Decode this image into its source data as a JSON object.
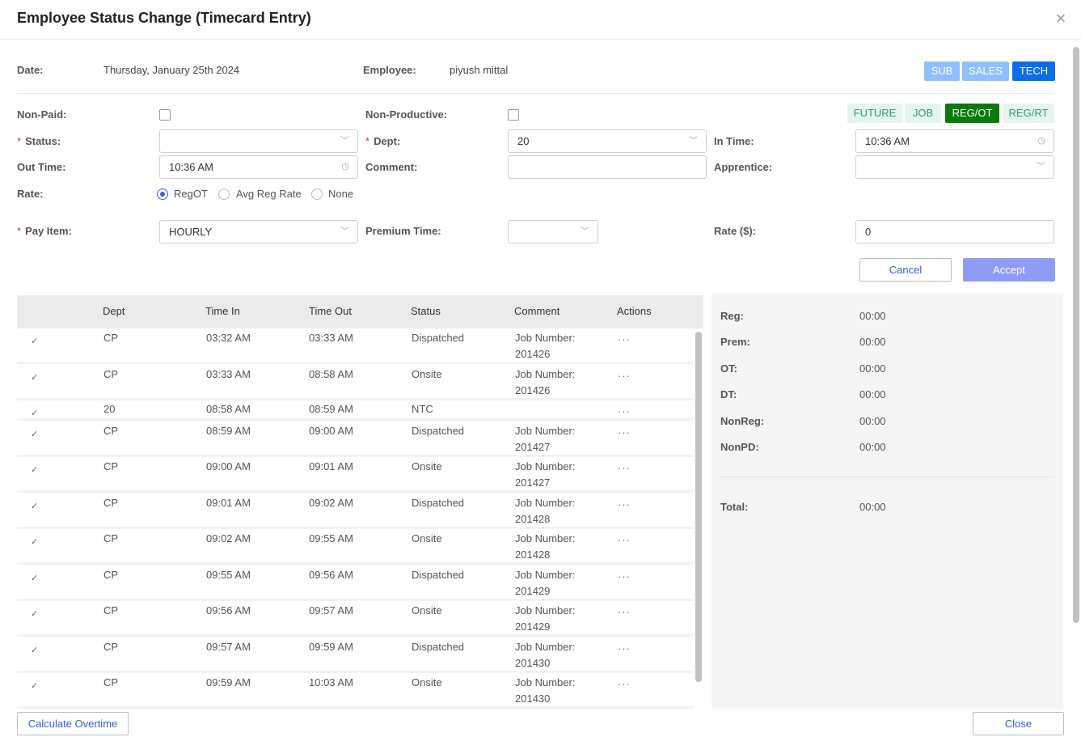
{
  "dialog": {
    "title": "Employee Status Change (Timecard Entry)"
  },
  "info": {
    "date_label": "Date:",
    "date_value": "Thursday, January 25th 2024",
    "employee_label": "Employee:",
    "employee_value": "piyush mittal"
  },
  "type_tabs": [
    "SUB",
    "SALES",
    "TECH"
  ],
  "mode_tabs": [
    "FUTURE",
    "JOB",
    "REG/OT",
    "REG/RT"
  ],
  "form": {
    "non_paid_label": "Non-Paid:",
    "non_productive_label": "Non-Productive:",
    "status_label": "Status:",
    "status_value": "",
    "dept_label": "Dept:",
    "dept_value": "20",
    "in_time_label": "In Time:",
    "in_time_value": "10:36 AM",
    "out_time_label": "Out Time:",
    "out_time_value": "10:36 AM",
    "comment_label": "Comment:",
    "comment_value": "",
    "apprentice_label": "Apprentice:",
    "apprentice_value": "",
    "rate_label": "Rate:",
    "rate_options": [
      "RegOT",
      "Avg Reg Rate",
      "None"
    ],
    "rate_selected": "RegOT",
    "pay_item_label": "Pay Item:",
    "pay_item_value": "HOURLY",
    "premium_time_label": "Premium Time:",
    "premium_time_value": "",
    "rate_dollar_label": "Rate ($):",
    "rate_dollar_value": "0",
    "required_mark": "*"
  },
  "buttons": {
    "cancel": "Cancel",
    "accept": "Accept",
    "calculate_overtime": "Calculate Overtime",
    "close": "Close"
  },
  "table": {
    "columns": [
      "Dept",
      "Time In",
      "Time Out",
      "Status",
      "Comment",
      "Actions"
    ],
    "actions_glyph": "···",
    "rows": [
      {
        "dept": "CP",
        "time_in": "03:32 AM",
        "time_out": "03:33 AM",
        "status": "Dispatched",
        "comment1": "Job Number:",
        "comment2": "201426"
      },
      {
        "dept": "CP",
        "time_in": "03:33 AM",
        "time_out": "08:58 AM",
        "status": "Onsite",
        "comment1": "Job Number:",
        "comment2": "201426"
      },
      {
        "dept": "20",
        "time_in": "08:58 AM",
        "time_out": "08:59 AM",
        "status": "NTC",
        "comment1": "",
        "comment2": ""
      },
      {
        "dept": "CP",
        "time_in": "08:59 AM",
        "time_out": "09:00 AM",
        "status": "Dispatched",
        "comment1": "Job Number:",
        "comment2": "201427"
      },
      {
        "dept": "CP",
        "time_in": "09:00 AM",
        "time_out": "09:01 AM",
        "status": "Onsite",
        "comment1": "Job Number:",
        "comment2": "201427"
      },
      {
        "dept": "CP",
        "time_in": "09:01 AM",
        "time_out": "09:02 AM",
        "status": "Dispatched",
        "comment1": "Job Number:",
        "comment2": "201428"
      },
      {
        "dept": "CP",
        "time_in": "09:02 AM",
        "time_out": "09:55 AM",
        "status": "Onsite",
        "comment1": "Job Number:",
        "comment2": "201428"
      },
      {
        "dept": "CP",
        "time_in": "09:55 AM",
        "time_out": "09:56 AM",
        "status": "Dispatched",
        "comment1": "Job Number:",
        "comment2": "201429"
      },
      {
        "dept": "CP",
        "time_in": "09:56 AM",
        "time_out": "09:57 AM",
        "status": "Onsite",
        "comment1": "Job Number:",
        "comment2": "201429"
      },
      {
        "dept": "CP",
        "time_in": "09:57 AM",
        "time_out": "09:59 AM",
        "status": "Dispatched",
        "comment1": "Job Number:",
        "comment2": "201430"
      },
      {
        "dept": "CP",
        "time_in": "09:59 AM",
        "time_out": "10:03 AM",
        "status": "Onsite",
        "comment1": "Job Number:",
        "comment2": "201430"
      }
    ]
  },
  "summary": {
    "rows": [
      {
        "label": "Reg:",
        "value": "00:00"
      },
      {
        "label": "Prem:",
        "value": "00:00"
      },
      {
        "label": "OT:",
        "value": "00:00"
      },
      {
        "label": "DT:",
        "value": "00:00"
      },
      {
        "label": "NonReg:",
        "value": "00:00"
      },
      {
        "label": "NonPD:",
        "value": "00:00"
      }
    ],
    "total_label": "Total:",
    "total_value": "00:00"
  }
}
